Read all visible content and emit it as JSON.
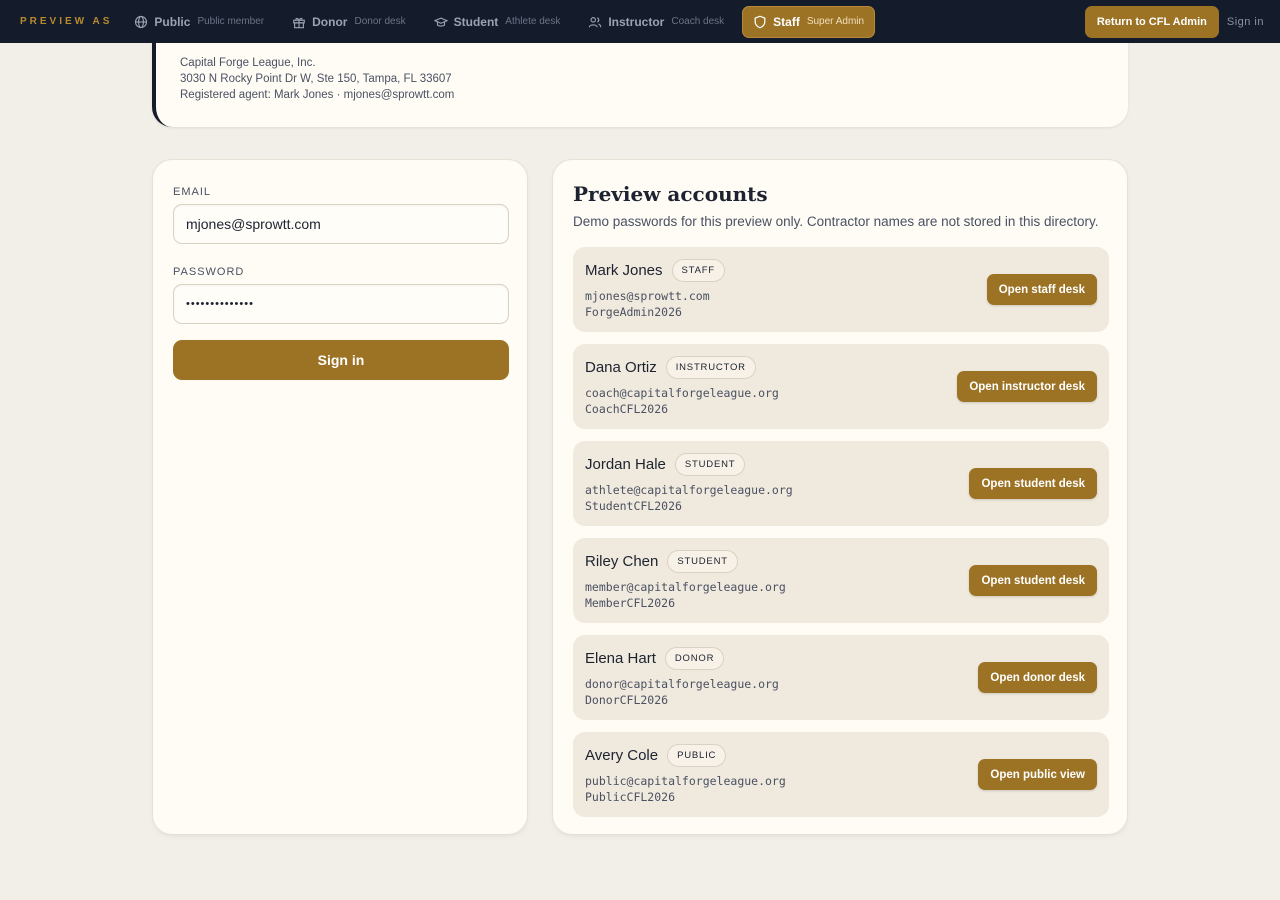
{
  "topbar": {
    "preview_label": "PREVIEW AS",
    "roles": [
      {
        "name": "Public",
        "desc": "Public member",
        "icon": "globe-icon",
        "active": false
      },
      {
        "name": "Donor",
        "desc": "Donor desk",
        "icon": "gift-icon",
        "active": false
      },
      {
        "name": "Student",
        "desc": "Athlete desk",
        "icon": "graduation-cap-icon",
        "active": false
      },
      {
        "name": "Instructor",
        "desc": "Coach desk",
        "icon": "users-icon",
        "active": false
      },
      {
        "name": "Staff",
        "desc": "Super Admin",
        "icon": "shield-icon",
        "active": true
      }
    ],
    "return_label": "Return to CFL Admin",
    "signin_label": "Sign in"
  },
  "entity": {
    "name": "Capital Forge League, Inc.",
    "address": "3030 N Rocky Point Dr W, Ste 150, Tampa, FL 33607",
    "agent": "Registered agent: Mark Jones · mjones@sprowtt.com"
  },
  "login": {
    "email_label": "EMAIL",
    "email_value": "mjones@sprowtt.com",
    "password_label": "PASSWORD",
    "password_value": "••••••••••••••",
    "submit_label": "Sign in"
  },
  "accounts": {
    "title": "Preview accounts",
    "subtitle": "Demo passwords for this preview only. Contractor names are not stored in this directory.",
    "items": [
      {
        "name": "Mark Jones",
        "role": "STAFF",
        "email": "mjones@sprowtt.com",
        "password": "ForgeAdmin2026",
        "button": "Open staff desk"
      },
      {
        "name": "Dana Ortiz",
        "role": "INSTRUCTOR",
        "email": "coach@capitalforgeleague.org",
        "password": "CoachCFL2026",
        "button": "Open instructor desk"
      },
      {
        "name": "Jordan Hale",
        "role": "STUDENT",
        "email": "athlete@capitalforgeleague.org",
        "password": "StudentCFL2026",
        "button": "Open student desk"
      },
      {
        "name": "Riley Chen",
        "role": "STUDENT",
        "email": "member@capitalforgeleague.org",
        "password": "MemberCFL2026",
        "button": "Open student desk"
      },
      {
        "name": "Elena Hart",
        "role": "DONOR",
        "email": "donor@capitalforgeleague.org",
        "password": "DonorCFL2026",
        "button": "Open donor desk"
      },
      {
        "name": "Avery Cole",
        "role": "PUBLIC",
        "email": "public@capitalforgeleague.org",
        "password": "PublicCFL2026",
        "button": "Open public view"
      }
    ]
  },
  "colors": {
    "accent": "#9c7325",
    "topbar": "#141c2b",
    "background": "#f2efe8",
    "card": "#fffcf5",
    "account_row": "#f0e9dd"
  }
}
